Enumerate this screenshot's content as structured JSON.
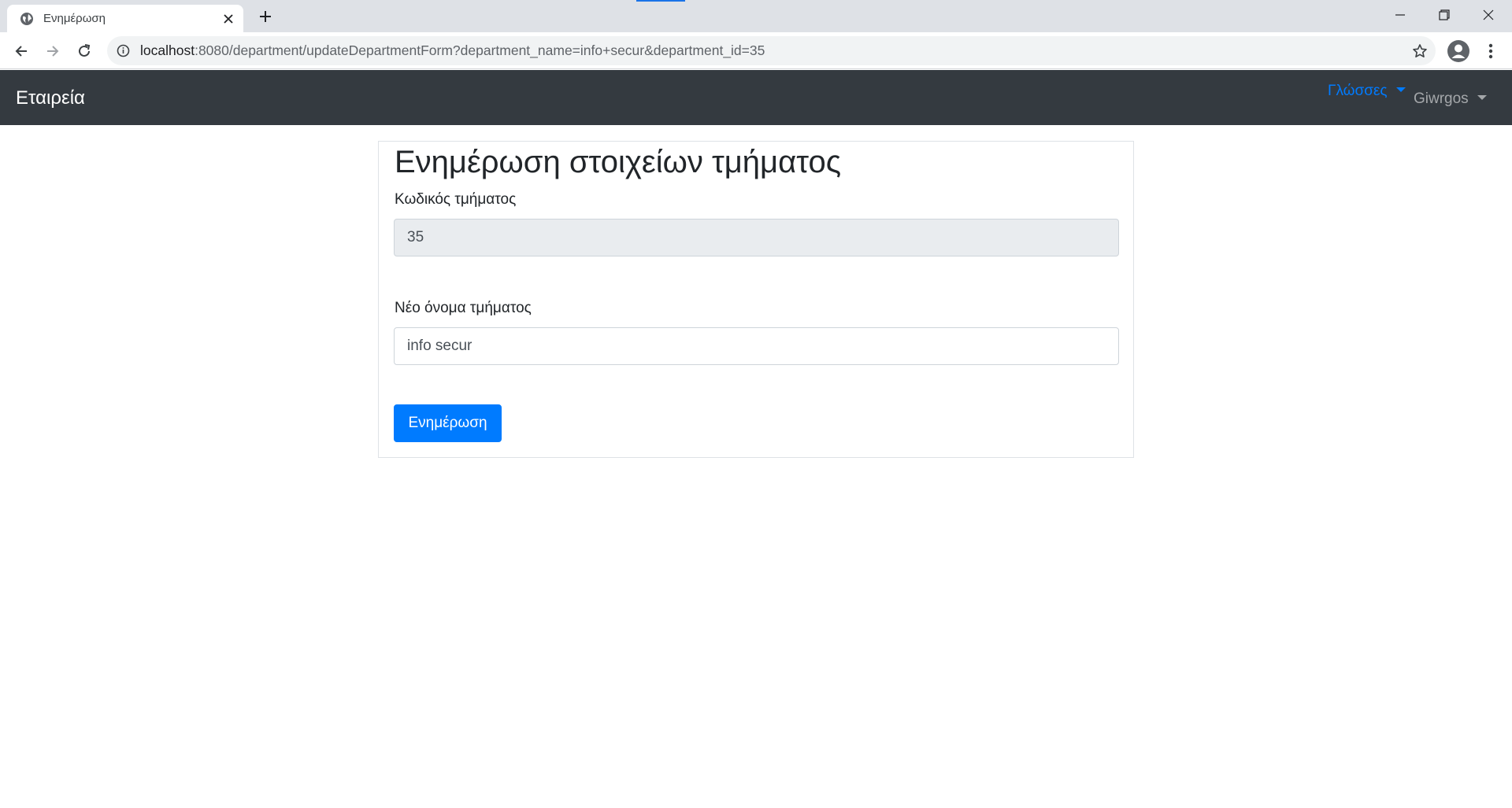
{
  "browser": {
    "tab_title": "Ενημέρωση",
    "url_host": "localhost",
    "url_rest": ":8080/department/updateDepartmentForm?department_name=info+secur&department_id=35"
  },
  "navbar": {
    "brand": "Εταιρεία",
    "languages_label": "Γλώσσες",
    "user_label": "Giwrgos"
  },
  "form": {
    "title": "Ενημέρωση στοιχείων τμήματος",
    "id_label": "Κωδικός τμήματος",
    "id_value": "35",
    "name_label": "Νέο όνομα τμήματος",
    "name_value": "info secur",
    "submit_label": "Ενημέρωση"
  },
  "colors": {
    "navbar_bg": "#343a40",
    "primary": "#007bff",
    "readonly_bg": "#e9ecef"
  }
}
